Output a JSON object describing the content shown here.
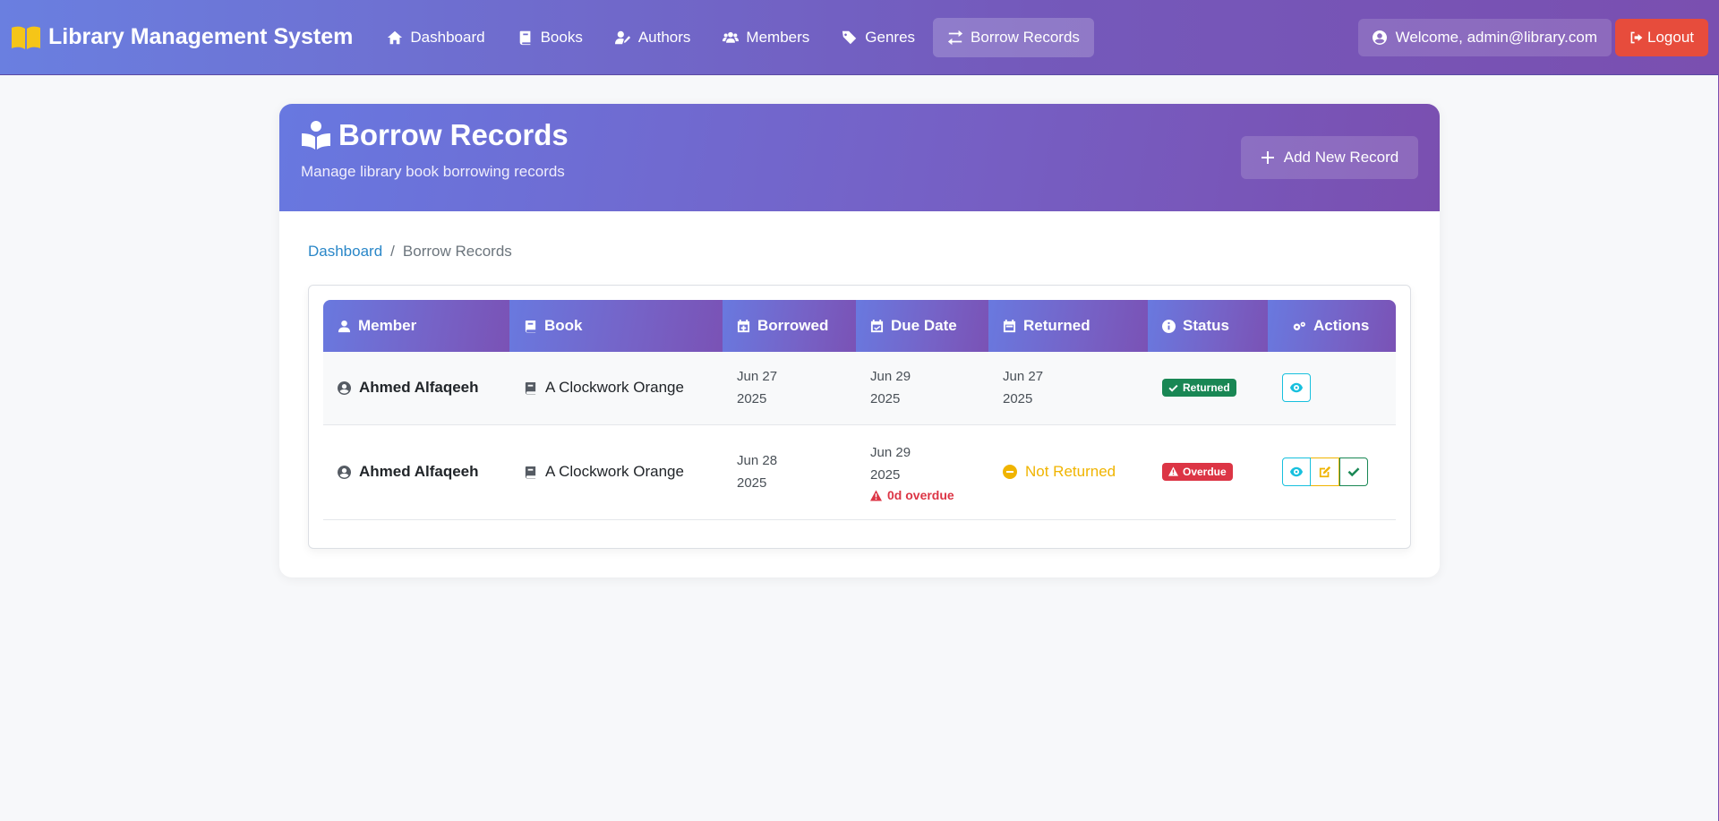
{
  "navbar": {
    "brand": "Library Management System",
    "items": [
      {
        "label": "Dashboard"
      },
      {
        "label": "Books"
      },
      {
        "label": "Authors"
      },
      {
        "label": "Members"
      },
      {
        "label": "Genres"
      },
      {
        "label": "Borrow Records"
      }
    ],
    "active_item": "Borrow Records",
    "welcome": "Welcome, admin@library.com",
    "logout": "Logout"
  },
  "header": {
    "title": "Borrow Records",
    "subtitle": "Manage library book borrowing records",
    "add_button": "Add New Record"
  },
  "breadcrumb": {
    "home": "Dashboard",
    "separator": "/",
    "current": "Borrow Records"
  },
  "table": {
    "columns": [
      "Member",
      "Book",
      "Borrowed",
      "Due Date",
      "Returned",
      "Status",
      "Actions"
    ],
    "rows": [
      {
        "member": "Ahmed Alfaqeeh",
        "book": "A Clockwork Orange",
        "borrowed": [
          "Jun 27",
          "2025"
        ],
        "due": [
          "Jun 29",
          "2025"
        ],
        "returned": [
          "Jun 27",
          "2025"
        ],
        "status": "Returned"
      },
      {
        "member": "Ahmed Alfaqeeh",
        "book": "A Clockwork Orange",
        "borrowed": [
          "Jun 28",
          "2025"
        ],
        "due": [
          "Jun 29",
          "2025"
        ],
        "overdue_note": "0d overdue",
        "returned_text": "Not Returned",
        "status": "Overdue"
      }
    ]
  },
  "colors": {
    "brand_icon": "#f5c518",
    "returned_badge": "#198754",
    "overdue_badge": "#dc3545",
    "not_returned": "#f0b400",
    "view_button": "#17c0de",
    "logout_button": "#e74c3c"
  }
}
